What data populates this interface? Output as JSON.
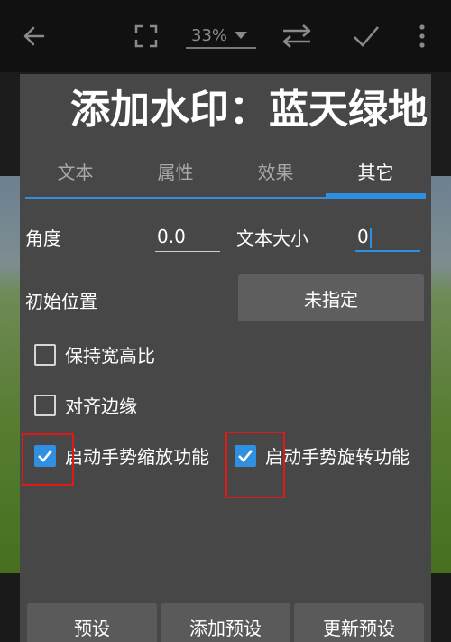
{
  "toolbar": {
    "back_icon": "arrow-left-icon",
    "fullscreen_icon": "fullscreen-icon",
    "zoom_value": "33%",
    "swap_icon": "swap-arrows-icon",
    "confirm_icon": "checkmark-icon",
    "more_icon": "more-vertical-icon"
  },
  "dialog": {
    "title": "添加水印：蓝天绿地",
    "tabs": [
      {
        "label": "文本"
      },
      {
        "label": "属性"
      },
      {
        "label": "效果"
      },
      {
        "label": "其它"
      }
    ],
    "active_tab": "其它",
    "angle_label": "角度",
    "angle_value": "0.0",
    "text_size_label": "文本大小",
    "text_size_value": "0",
    "initial_position_label": "初始位置",
    "initial_position_value": "未指定",
    "checkboxes": [
      {
        "label": "保持宽高比",
        "checked": false
      },
      {
        "label": "对齐边缘",
        "checked": false
      },
      {
        "label": "启动手势缩放功能",
        "checked": true
      },
      {
        "label": "启动手势旋转功能",
        "checked": true
      }
    ],
    "buttons": {
      "preset": "预设",
      "add_preset": "添加预设",
      "update_preset": "更新预设"
    }
  },
  "colors": {
    "accent": "#2f8fe0",
    "dialog_bg": "#474747",
    "highlight": "#e01818"
  }
}
